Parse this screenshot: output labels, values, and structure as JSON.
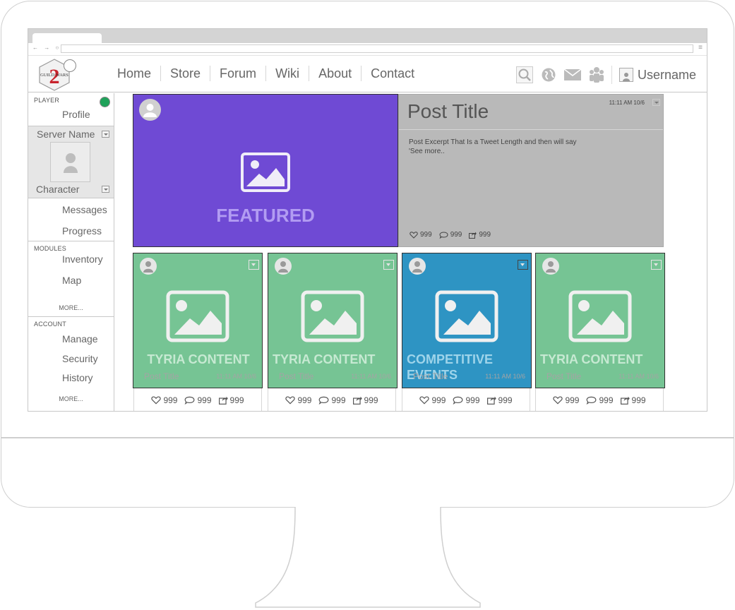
{
  "nav": {
    "items": [
      "Home",
      "Store",
      "Forum",
      "Wiki",
      "About",
      "Contact"
    ]
  },
  "header": {
    "username": "Username",
    "icons": [
      "search-icon",
      "globe-icon",
      "mail-icon",
      "group-icon",
      "user-icon"
    ]
  },
  "logo": {
    "name": "guild-wars-2-logo",
    "text": "GUILD WARS"
  },
  "sidebar": {
    "player_caption": "PLAYER",
    "profile": "Profile",
    "server_name": "Server Name",
    "character": "Character",
    "messages": "Messages",
    "progress": "Progress",
    "modules_caption": "MODULES",
    "inventory": "Inventory",
    "map": "Map",
    "more1": "MORE...",
    "account_caption": "ACCOUNT",
    "manage": "Manage",
    "security": "Security",
    "history": "History",
    "more2": "MORE..."
  },
  "featured": {
    "label": "FEATURED",
    "color": "#6f4ad4"
  },
  "post": {
    "title": "Post Title",
    "time": "11:11 AM 10/6",
    "excerpt_line1": "Post Excerpt That Is a Tweet Length and then will say",
    "excerpt_line2": "'See more..",
    "likes": "999",
    "comments": "999",
    "shares": "999"
  },
  "cards": [
    {
      "label": "TYRIA CONTENT",
      "title": "Post Title",
      "time": "11:11 AM 10/6",
      "likes": "999",
      "comments": "999",
      "shares": "999",
      "color": "#76c494"
    },
    {
      "label": "TYRIA CONTENT",
      "title": "Post Title",
      "time": "11:11 AM 10/6",
      "likes": "999",
      "comments": "999",
      "shares": "999",
      "color": "#76c494"
    },
    {
      "label_line1": "COMPETITIVE",
      "label_line2": "EVENTS",
      "title": "Post Title",
      "time": "11:11 AM 10/6",
      "likes": "999",
      "comments": "999",
      "shares": "999",
      "color": "#2e94c3"
    },
    {
      "label": "TYRIA CONTENT",
      "title": "Post Title",
      "time": "11:11 AM 10/6",
      "likes": "999",
      "comments": "999",
      "shares": "999",
      "color": "#76c494"
    }
  ]
}
